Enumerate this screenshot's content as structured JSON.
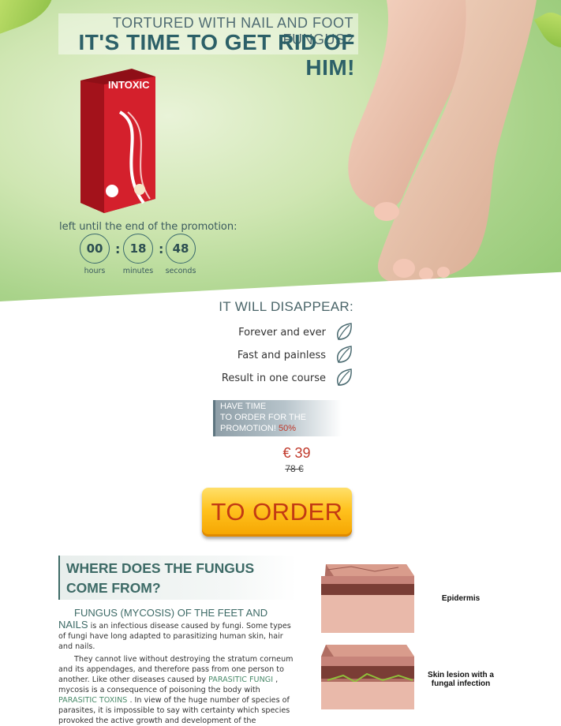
{
  "hero": {
    "subtitle": "TORTURED WITH NAIL AND FOOT FUNGUS?",
    "title": "IT'S TIME TO GET RID OF HIM!"
  },
  "product": {
    "brand": "INTOXIC",
    "icon": "product-box-image"
  },
  "countdown": {
    "label": "left until the end of the promotion:",
    "hours": "00",
    "minutes": "18",
    "seconds": "48",
    "hours_label": "hours",
    "minutes_label": "minutes",
    "seconds_label": "seconds",
    "separator": ":"
  },
  "disappear": {
    "title": "IT WILL DISAPPEAR:",
    "items": [
      {
        "label": "Forever and ever",
        "icon": "leaf-icon"
      },
      {
        "label": "Fast and painless",
        "icon": "leaf-icon"
      },
      {
        "label": "Result in one course",
        "icon": "leaf-icon"
      }
    ]
  },
  "promo": {
    "line1": "HAVE TIME",
    "line2": "TO ORDER FOR THE",
    "line3": "PROMOTION!",
    "percent": "50%"
  },
  "price": {
    "new": "€ 39",
    "old": "78 €"
  },
  "order_button": "TO ORDER",
  "article": {
    "title": "WHERE DOES THE FUNGUS COME FROM?",
    "p1_lead": "FUNGUS (MYCOSIS) OF THE FEET AND NAILS",
    "p1_rest": " is an infectious disease caused by fungi. Some types of fungi have long adapted to parasitizing human skin, hair and nails.",
    "p2_a": "They cannot live without destroying the stratum corneum and its appendages, and therefore pass from one person to another. Like other diseases caused by ",
    "p2_link1": "PARASITIC FUNGI",
    "p2_b": " , mycosis is a consequence of poisoning the body with ",
    "p2_link2": "PARASITIC TOXINS",
    "p2_c": " . In view of the huge number of species of parasites, it is impossible to say with certainty which species provoked the active growth and development of the"
  },
  "skin": {
    "caption1": "Epidermis",
    "caption2": "Skin lesion with a fungal infection"
  },
  "colors": {
    "accent_teal": "#3d6a66",
    "price_red": "#c0392b",
    "button_yellow": "#ffc21e"
  }
}
